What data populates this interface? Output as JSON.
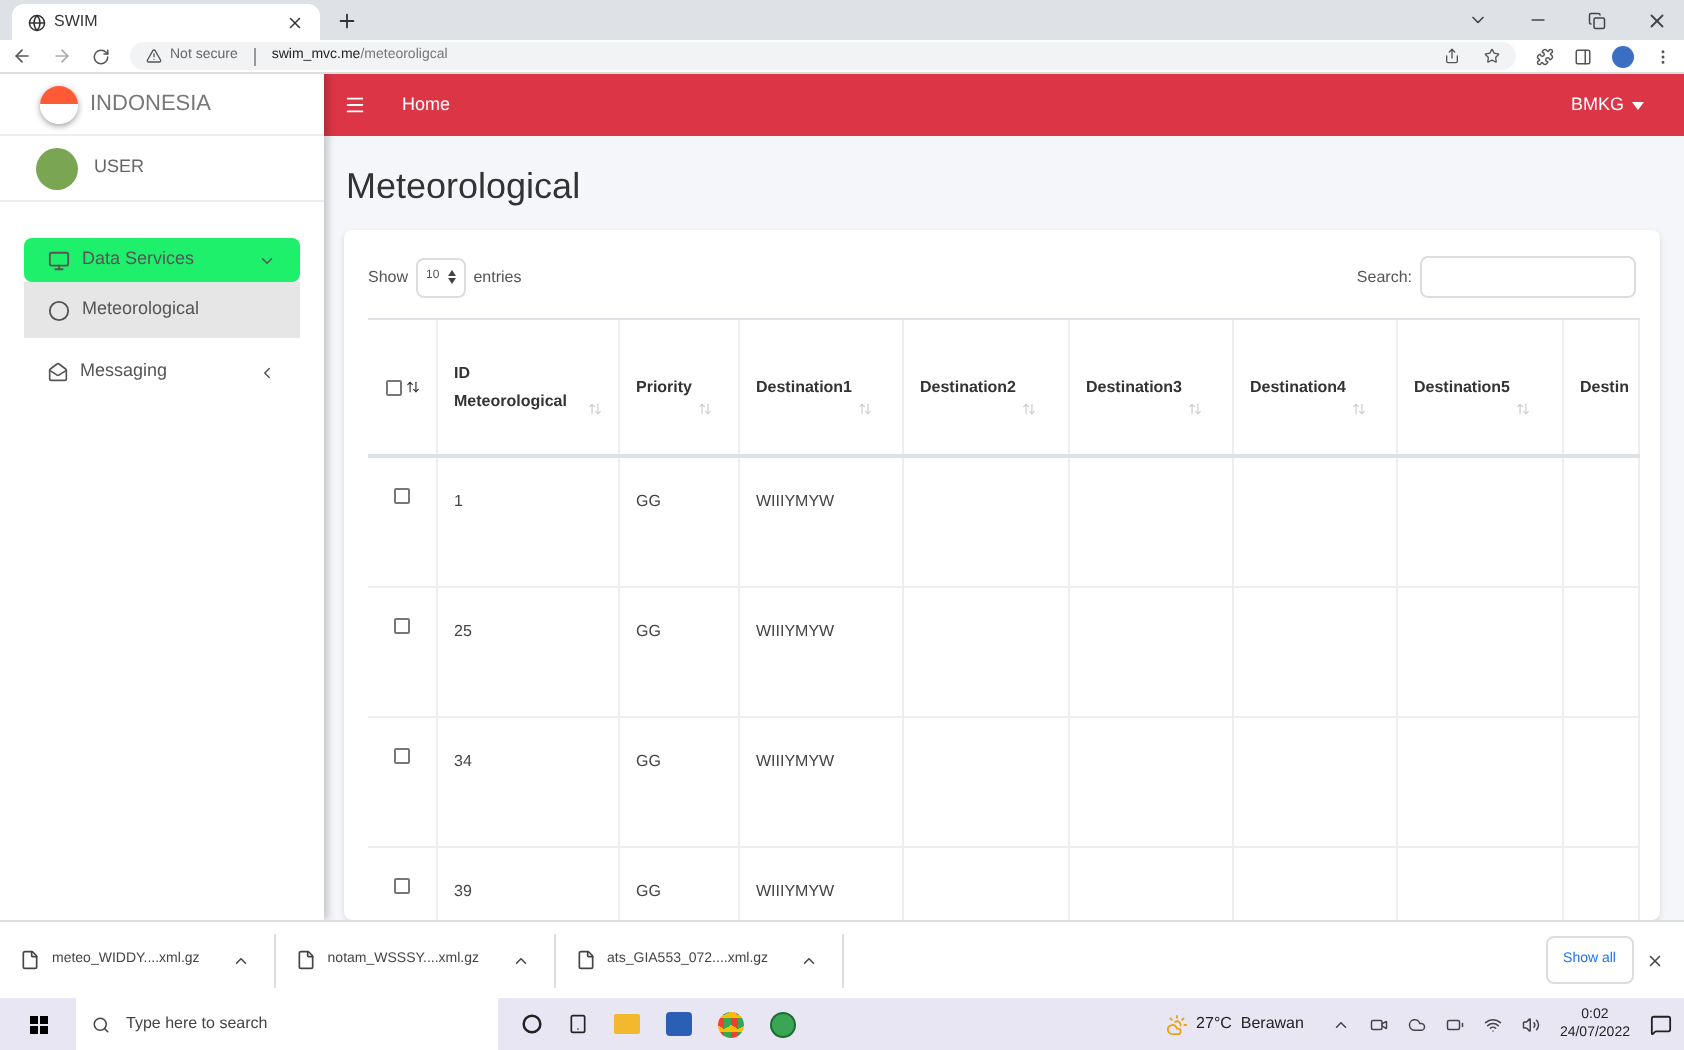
{
  "browser": {
    "tabs": [
      {
        "title": "SWIM",
        "selected": true
      }
    ],
    "address": {
      "warning": "Not secure",
      "host": "swim_mvc.me",
      "path": "/meteoroligcal"
    }
  },
  "brand": "INDONESIA",
  "user": "USER",
  "sidebar": {
    "items": [
      {
        "label": "Data Services",
        "selected": true,
        "expanded": true,
        "children": [
          {
            "label": "Meteorological",
            "selected": true
          }
        ]
      },
      {
        "label": "Messaging",
        "selected": false,
        "expanded": false
      }
    ]
  },
  "navbar": {
    "link": "Home",
    "account": "BMKG"
  },
  "page_title": "Meteorological",
  "table_controls": {
    "show_label": "Show",
    "page_size": "10",
    "entries_label": "entries",
    "search_label": "Search:"
  },
  "table": {
    "select_all_checked": false,
    "columns": [
      {
        "label": "ID Meteorological"
      },
      {
        "label": "Priority"
      },
      {
        "label": "Destination1"
      },
      {
        "label": "Destination2"
      },
      {
        "label": "Destination3"
      },
      {
        "label": "Destination4"
      },
      {
        "label": "Destination5"
      },
      {
        "label": "Destin"
      }
    ],
    "rows": [
      {
        "checked": false,
        "cells": [
          "1",
          "GG",
          "WIIIYMYW"
        ]
      },
      {
        "checked": false,
        "cells": [
          "25",
          "GG",
          "WIIIYMYW"
        ]
      },
      {
        "checked": false,
        "cells": [
          "34",
          "GG",
          "WIIIYMYW"
        ]
      },
      {
        "checked": false,
        "cells": [
          "39",
          "GG",
          "WIIIYMYW"
        ]
      }
    ]
  },
  "downloads": {
    "files": [
      "meteo_WIDDY....xml.gz",
      "notam_WSSSY....xml.gz",
      "ats_GIA553_072....xml.gz"
    ],
    "show_all": "Show all"
  },
  "taskbar": {
    "search_placeholder": "Type here to search",
    "weather": "27°C  Berawan",
    "time": "0:02",
    "date": "24/07/2022"
  }
}
